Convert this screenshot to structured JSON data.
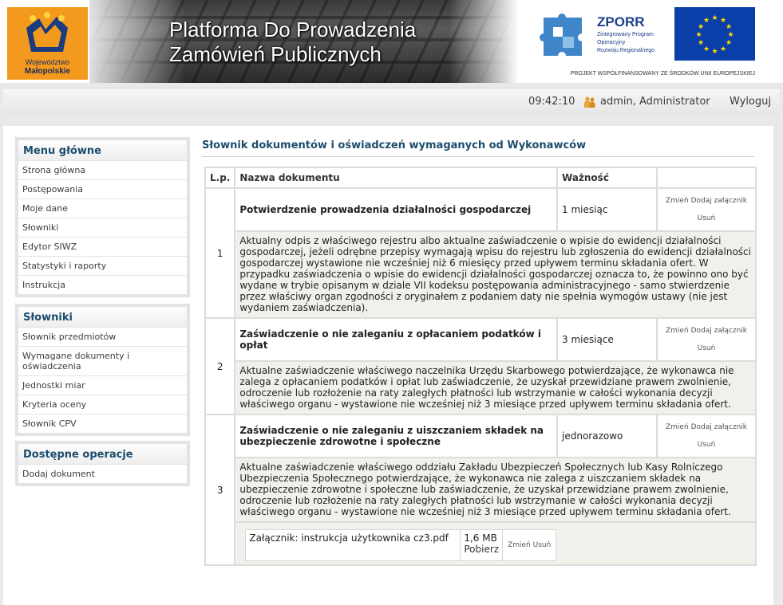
{
  "header": {
    "logo_line1": "Województwo",
    "logo_line2": "Małopolskie",
    "title_line1": "Platforma Do Prowadzenia",
    "title_line2": "Zamówień Publicznych",
    "zporr_title": "ZPORR",
    "zporr_subtitle": [
      "Zintegrowany Program",
      "Operacyjny",
      "Rozwoju Regionalnego"
    ],
    "projekt_text": "PROJEKT WSPÓŁFINANSOWANY ZE ŚRODKÓW UNII EUROPEJSKIEJ"
  },
  "topbar": {
    "time": "09:42:10",
    "user": "admin, Administrator",
    "logout": "Wyloguj"
  },
  "menus": [
    {
      "title": "Menu główne",
      "items": [
        "Strona główna",
        "Postępowania",
        "Moje dane",
        "Słowniki",
        "Edytor SIWZ",
        "Statystyki i raporty",
        "Instrukcja"
      ]
    },
    {
      "title": "Słowniki",
      "items": [
        "Słownik przedmiotów",
        "Wymagane dokumenty i oświadczenia",
        "Jednostki miar",
        "Kryteria oceny",
        "Słownik CPV"
      ]
    },
    {
      "title": "Dostępne operacje",
      "items": [
        "Dodaj dokument"
      ]
    }
  ],
  "content": {
    "title": "Słownik dokumentów i oświadczeń wymaganych od Wykonawców",
    "columns": [
      "L.p.",
      "Nazwa dokumentu",
      "Ważność",
      ""
    ],
    "action_labels": {
      "change": "Zmień",
      "add_attachment": "Dodaj załącznik",
      "delete": "Usuń"
    },
    "rows": [
      {
        "lp": "1",
        "name": "Potwierdzenie prowadzenia działalności gospodarczej",
        "validity": "1 miesiąc",
        "description": "Aktualny odpis z właściwego rejestru albo aktualne zaświadczenie o wpisie do ewidencji działalności gospodarczej, jeżeli odrębne przepisy wymagają wpisu do rejestru lub zgłoszenia do ewidencji działalności gospodarczej wystawione nie wcześniej niż 6 miesięcy przed upływem terminu składania ofert. W przypadku zaświadczenia o wpisie do ewidencji działalności gospodarczej oznacza to, że powinno ono być wydane w trybie opisanym w dziale VII kodeksu postępowania administracyjnego - samo stwierdzenie przez właściwy organ zgodności z oryginałem z podaniem daty nie spełnia wymogów ustawy (nie jest wydaniem zaświadczenia)."
      },
      {
        "lp": "2",
        "name": "Zaświadczenie o nie zaleganiu z opłacaniem podatków i opłat",
        "validity": "3 miesiące",
        "description": "Aktualne zaświadczenie właściwego naczelnika Urzędu Skarbowego potwierdzające, że wykonawca nie zalega z opłacaniem podatków i opłat lub zaświadczenie, że uzyskał przewidziane prawem zwolnienie, odroczenie lub rozłożenie na raty zaległych płatności lub wstrzymanie w całości wykonania decyzji właściwego organu - wystawione nie wcześniej niż 3 miesiące przed upływem terminu składania ofert."
      },
      {
        "lp": "3",
        "name": "Zaświadczenie o nie zaleganiu z uiszczaniem składek na ubezpieczenie zdrowotne i społeczne",
        "validity": "jednorazowo",
        "description": "Aktualne zaświadczenie właściwego oddziału Zakładu Ubezpieczeń Społecznych lub Kasy Rolniczego Ubezpieczenia Społecznego potwierdzające, że wykonawca nie zalega z uiszczaniem składek na ubezpieczenie zdrowotne i społeczne lub zaświadczenie, że uzyskał przewidziane prawem zwolnienie, odroczenie lub rozłożenie na raty zaległych płatności lub wstrzymanie w całości wykonania decyzji właściwego organu - wystawione nie wcześniej niż 3 miesiące przed upływem terminu składania ofert.",
        "attachment": {
          "label": "Załącznik: instrukcja użytkownika cz3.pdf",
          "size": "1,6 MB",
          "download": "Pobierz"
        }
      }
    ]
  },
  "colors": {
    "accent_blue": "#1c4d6e",
    "logo_orange": "#f39a1e",
    "eu_blue": "#0a3ea8",
    "eu_star": "#ffdd00",
    "zporr_blue": "#1e3f8c"
  }
}
